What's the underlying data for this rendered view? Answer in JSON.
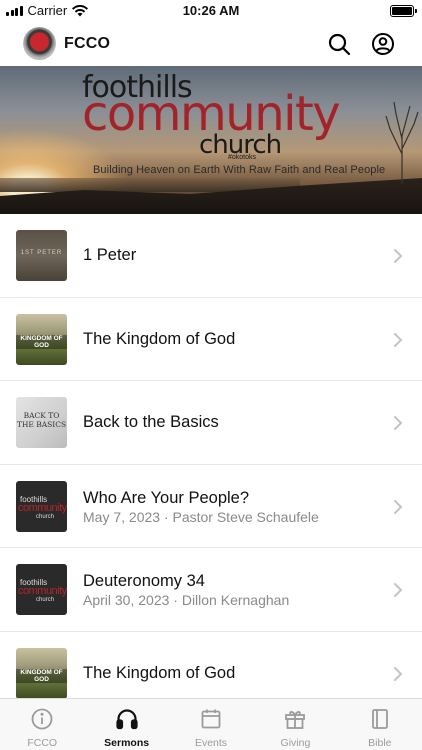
{
  "status_bar": {
    "carrier": "Carrier",
    "time": "10:26 AM"
  },
  "header": {
    "title": "FCCO",
    "search_icon": "search-icon",
    "account_icon": "account-icon"
  },
  "banner": {
    "line1": "foothills",
    "line2": "community",
    "line3": "church",
    "location": "#okotoks",
    "tagline": "Building Heaven on Earth With Raw Faith and Real People"
  },
  "sermons": [
    {
      "title": "1 Peter",
      "subtitle": "",
      "thumb_text": "1ST PETER"
    },
    {
      "title": "The Kingdom of God",
      "subtitle": "",
      "thumb_text": "KINGDOM OF GOD"
    },
    {
      "title": "Back to the Basics",
      "subtitle": "",
      "thumb_text": "BACK TO THE BASICS"
    },
    {
      "title": "Who Are Your People?",
      "subtitle": "May 7, 2023 · Pastor Steve Schaufele",
      "thumb_text": "foothills community church"
    },
    {
      "title": "Deuteronomy 34",
      "subtitle": "April 30, 2023 · Dillon Kernaghan",
      "thumb_text": "foothills community church"
    },
    {
      "title": "The Kingdom of God",
      "subtitle": "",
      "thumb_text": "KINGDOM OF GOD"
    }
  ],
  "tabs": [
    {
      "label": "FCCO",
      "icon": "info-icon",
      "active": false
    },
    {
      "label": "Sermons",
      "icon": "headphones-icon",
      "active": true
    },
    {
      "label": "Events",
      "icon": "calendar-icon",
      "active": false
    },
    {
      "label": "Giving",
      "icon": "gift-icon",
      "active": false
    },
    {
      "label": "Bible",
      "icon": "book-icon",
      "active": false
    }
  ],
  "colors": {
    "brand_red": "#a3232a",
    "active_tab": "#111111",
    "inactive_tab": "#9b9b9b"
  }
}
